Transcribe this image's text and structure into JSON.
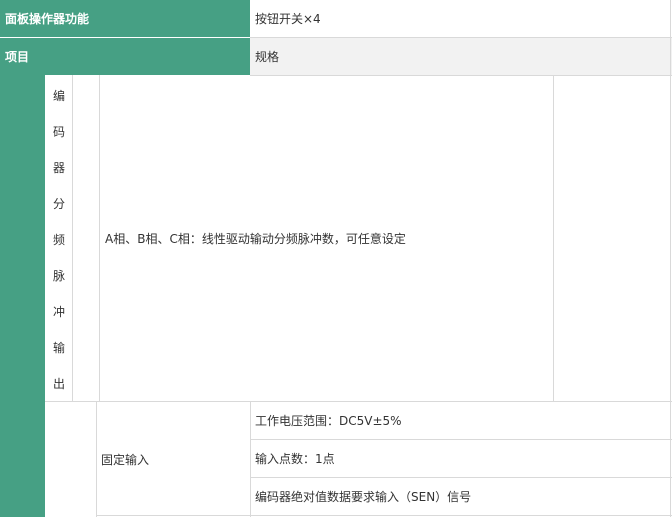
{
  "header_row": {
    "label": "面板操作器功能",
    "value": "按钮开关×4"
  },
  "item_row": {
    "label": "项目",
    "value": "规格"
  },
  "encoder": {
    "vertical_label": [
      "编",
      "码",
      "器",
      "分",
      "频",
      "脉",
      "冲",
      "输",
      "出"
    ],
    "description": "A相、B相、C相：线性驱动输动分频脉冲数，可任意设定"
  },
  "fixed_input": {
    "label": "固定输入",
    "specs": [
      "工作电压范围：DC5V±5%",
      "输入点数：1点",
      "编码器绝对值数据要求输入（SEN）信号"
    ]
  },
  "colors": {
    "accent": "#46a084",
    "grey_row": "#f2f2f2",
    "border": "#d9d9d9"
  }
}
